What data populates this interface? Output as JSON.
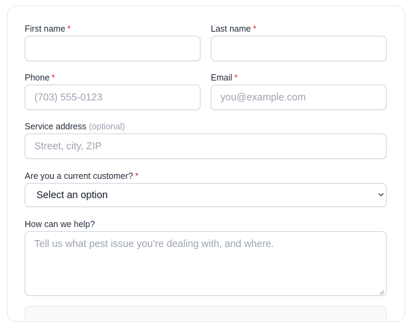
{
  "form": {
    "first_name": {
      "label": "First name",
      "required_mark": "*",
      "value": "",
      "placeholder": ""
    },
    "last_name": {
      "label": "Last name",
      "required_mark": "*",
      "value": "",
      "placeholder": ""
    },
    "phone": {
      "label": "Phone",
      "required_mark": "*",
      "value": "",
      "placeholder": "(703) 555-0123"
    },
    "email": {
      "label": "Email",
      "required_mark": "*",
      "value": "",
      "placeholder": "you@example.com"
    },
    "service_address": {
      "label": "Service address",
      "optional_note": "(optional)",
      "value": "",
      "placeholder": "Street, city, ZIP"
    },
    "current_customer": {
      "label": "Are you a current customer?",
      "required_mark": "*",
      "selected": "Select an option",
      "icon": "chevron-down-icon"
    },
    "help": {
      "label": "How can we help?",
      "value": "",
      "placeholder": "Tell us what pest issue you’re dealing with, and where."
    }
  },
  "colors": {
    "required": "#dc2626",
    "optional": "#9ca3af",
    "border": "#d1d5db",
    "placeholder": "#9ca3af"
  }
}
